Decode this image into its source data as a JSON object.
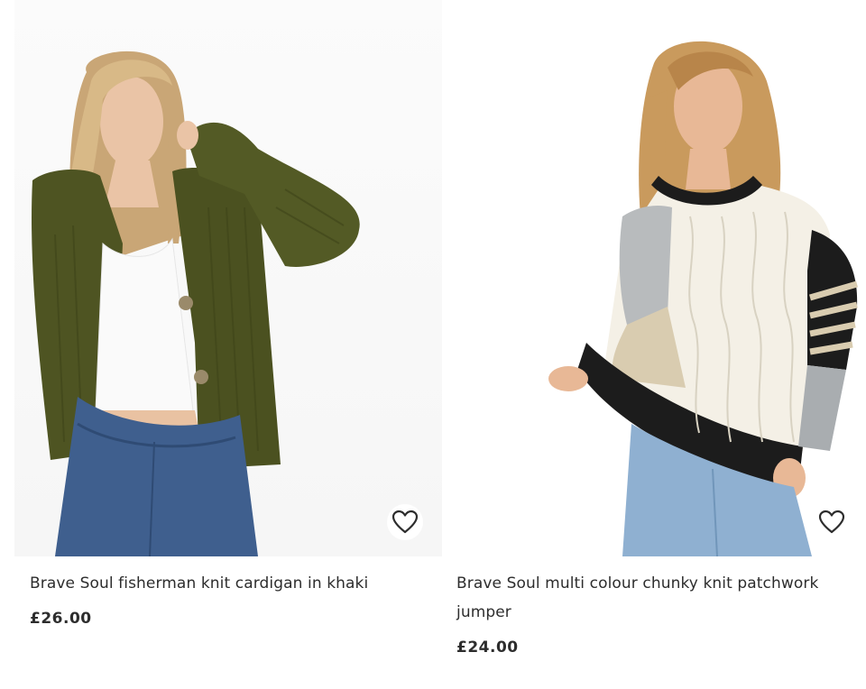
{
  "products": [
    {
      "title": "Brave Soul fisherman knit cardigan in khaki",
      "price": "£26.00",
      "image_alt": "Model wearing khaki fisherman knit cardigan over white crop top with blue jeans",
      "icon": "heart-outline-icon"
    },
    {
      "title": "Brave Soul multi colour chunky knit patchwork jumper",
      "price": "£24.00",
      "image_alt": "Model wearing multi colour cable knit patchwork jumper with light blue jeans",
      "icon": "heart-outline-icon"
    }
  ],
  "colors": {
    "text": "#2d2d2d",
    "background": "#ffffff",
    "khaki": "#4e5422",
    "jeans": "#3f5f8e"
  }
}
